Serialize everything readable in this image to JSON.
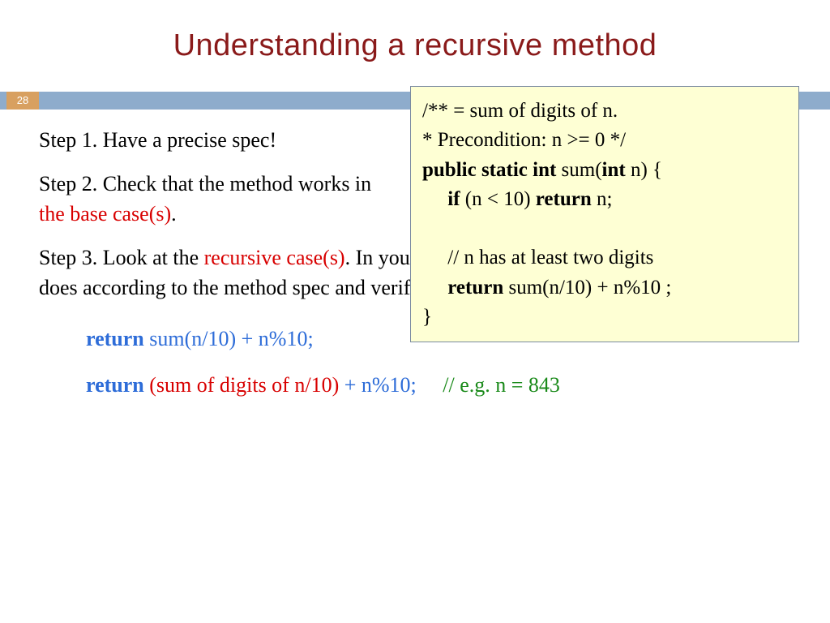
{
  "title": "Understanding a recursive method",
  "slide_no": "28",
  "steps": {
    "s1": "Step 1. Have a precise spec!",
    "s2a": "Step 2. Check that the method works in ",
    "s2b": "the base case(s)",
    "s2c": ".",
    "s3a": "Step 3. Look at the ",
    "s3b": "recursive case(s)",
    "s3c": ". In your mind replace each recursive call by what it does according to the method spec and verify that the correct result is then obtained."
  },
  "code": {
    "l1": "/** =  sum of digits of n.",
    "l2": "    * Precondition:  n >= 0 */",
    "l3a": "public static int",
    "l3b": " sum(",
    "l3c": "int",
    "l3d": " n) {",
    "l4a": "if",
    "l4b": " (n < 10) ",
    "l4c": "return",
    "l4d": " n;",
    "l5": "// n has at least two digits",
    "l6a": "return",
    "l6b": " sum(n/10)  +  n%10 ;",
    "l7": "}"
  },
  "examples": {
    "e1a": "return",
    "e1b": " sum(n/10)  +  n%10;",
    "e2a": "return",
    "e2b": " (sum of digits of n/10)",
    "e2c": "  +  n%10;",
    "e2d": "// e.g. n = 843"
  }
}
